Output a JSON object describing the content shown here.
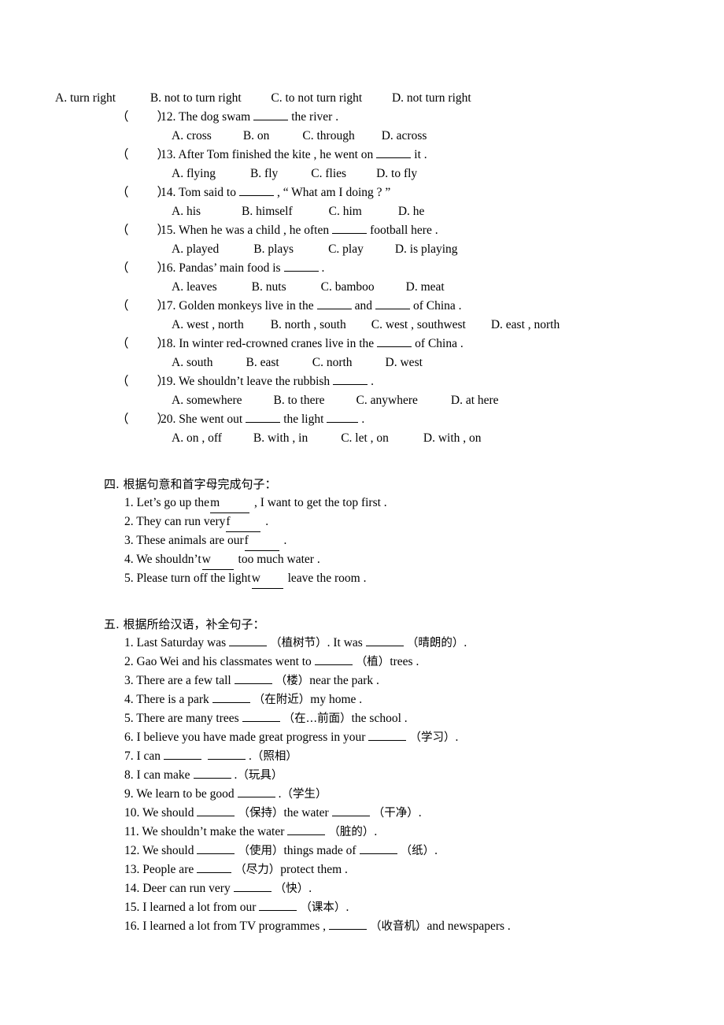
{
  "document": {
    "type": "english-exam-worksheet",
    "language_mix": "English with Simplified Chinese instructions"
  },
  "multiple_choice": {
    "orphan_options_line": {
      "a": "A. turn right",
      "b": "B. not to turn right",
      "c": "C. to not turn right",
      "d": "D. not turn right"
    },
    "paren_left": "（",
    "paren_right": "）",
    "questions": [
      {
        "number": "12.",
        "stem_before": "The dog swam",
        "stem_after": "the river .",
        "options": [
          "A. cross",
          "B. on",
          "C. through",
          "D. across"
        ]
      },
      {
        "number": "13.",
        "stem_before": "After Tom finished the kite , he went on",
        "stem_after": "it .",
        "options": [
          "A. flying",
          "B. fly",
          "C. flies",
          "D. to fly"
        ]
      },
      {
        "number": "14.",
        "stem_before": "Tom said to",
        "stem_after": ", “ What am I doing ? ”",
        "options": [
          "A. his",
          "B. himself",
          "C. him",
          "D. he"
        ]
      },
      {
        "number": "15.",
        "stem_before": "When he was a child , he often",
        "stem_after": "football here .",
        "options": [
          "A. played",
          "B. plays",
          "C. play",
          "D. is playing"
        ]
      },
      {
        "number": "16.",
        "stem_before": "Pandas’ main food is",
        "stem_after": ".",
        "options": [
          "A. leaves",
          "B. nuts",
          "C. bamboo",
          "D. meat"
        ]
      },
      {
        "number": "17.",
        "stem_before": "Golden monkeys live in the",
        "stem_middle": "and",
        "stem_after": "of China .",
        "options": [
          "A. west , north",
          "B. north , south",
          "C. west , southwest",
          "D. east , north"
        ]
      },
      {
        "number": "18.",
        "stem_before": "In winter red-crowned cranes live in the",
        "stem_after": "of China .",
        "options": [
          "A. south",
          "B. east",
          "C. north",
          "D. west"
        ]
      },
      {
        "number": "19.",
        "stem_before": "We shouldn’t leave the rubbish",
        "stem_after": ".",
        "options": [
          "A. somewhere",
          "B. to there",
          "C. anywhere",
          "D. at here"
        ]
      },
      {
        "number": "20.",
        "stem_before": "She went out",
        "stem_middle": "the light",
        "stem_after": ".",
        "options": [
          "A. on , off",
          "B. with , in",
          "C. let , on",
          "D. with , on"
        ]
      }
    ]
  },
  "section_four": {
    "heading": "四. 根据句意和首字母完成句子：",
    "items": [
      {
        "number": "1.",
        "before": "Let’s go up the",
        "hint_letter": "m",
        "after": ", I want to get the top first ."
      },
      {
        "number": "2.",
        "before": "They can run very",
        "hint_letter": "f",
        "after": "."
      },
      {
        "number": "3.",
        "before": "These animals are our",
        "hint_letter": "f",
        "after": "."
      },
      {
        "number": "4.",
        "before": "We shouldn’t",
        "hint_letter": "w",
        "after": "too much water ."
      },
      {
        "number": "5.",
        "before": "Please turn off the light",
        "hint_letter": "w",
        "after": "leave the room ."
      }
    ]
  },
  "section_five": {
    "heading": "五. 根据所给汉语，补全句子：",
    "items": [
      {
        "number": "1.",
        "p1": "Last Saturday was",
        "c1": "（植树节）",
        "p2": ". It was",
        "c2": "（晴朗的）",
        "p3": "."
      },
      {
        "number": "2.",
        "p1": "Gao Wei and his classmates went to",
        "c1": "（植）",
        "p2": "trees ."
      },
      {
        "number": "3.",
        "p1": "There are a few tall",
        "c1": "（楼）",
        "p2": "near the park ."
      },
      {
        "number": "4.",
        "p1": "There is a park",
        "c1": "（在附近）",
        "p2": "my home ."
      },
      {
        "number": "5.",
        "p1": "There are many trees",
        "c1": "（在…前面）",
        "p2": "the school ."
      },
      {
        "number": "6.",
        "p1": "I believe you have made great progress in your",
        "c1": "（学习）",
        "p2": "."
      },
      {
        "number": "7.",
        "p1": "I can",
        "p2": ".",
        "c1": "（照相）",
        "double_blank": true
      },
      {
        "number": "8.",
        "p1": "I can make",
        "p2": ".",
        "c1": "（玩具）"
      },
      {
        "number": "9.",
        "p1": "We learn to be good",
        "p2": ".",
        "c1": "（学生）"
      },
      {
        "number": "10.",
        "p1": "We should",
        "c1": "（保持）",
        "p2": "the water",
        "c2": "（干净）",
        "p3": "."
      },
      {
        "number": "11.",
        "p1": "We shouldn’t make the water",
        "c1": "（脏的）",
        "p2": "."
      },
      {
        "number": "12.",
        "p1": "We should",
        "c1": "（使用）",
        "p2": "things made of",
        "c2": "（纸）",
        "p3": "."
      },
      {
        "number": "13.",
        "p1": "People are",
        "c1": "（尽力）",
        "p2": "protect them ."
      },
      {
        "number": "14.",
        "p1": "Deer can run very",
        "c1": "（快）",
        "p2": "."
      },
      {
        "number": "15.",
        "p1": "I learned a lot from our",
        "c1": "（课本）",
        "p2": "."
      },
      {
        "number": "16.",
        "p1": "I learned a lot from TV programmes ,",
        "c1": "（收音机）",
        "p2": "and newspapers ."
      }
    ]
  }
}
